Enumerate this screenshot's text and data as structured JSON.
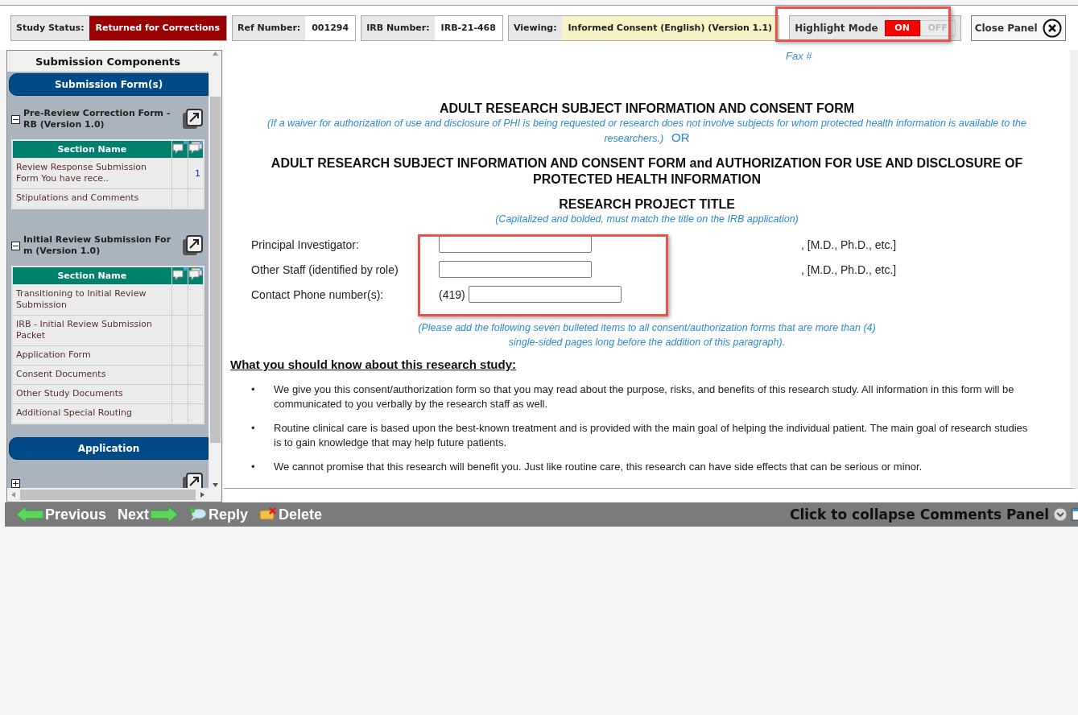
{
  "status_bar": {
    "fields": [
      {
        "label": "Study Status:",
        "value": "Returned for Corrections",
        "kind": "alert"
      },
      {
        "label": "Ref Number:",
        "value": "001294",
        "kind": "plain"
      },
      {
        "label": "IRB Number:",
        "value": "IRB-21-468",
        "kind": "plain"
      },
      {
        "label": "Viewing:",
        "value": "Informed Consent (English) (Version 1.1)",
        "kind": "note"
      }
    ],
    "highlight": {
      "label": "Highlight Mode",
      "options": [
        {
          "label": "ON",
          "selected": true
        },
        {
          "label": "OFF",
          "selected": false
        }
      ]
    },
    "close_label": "Close Panel"
  },
  "sidebar": {
    "title": "Submission Components",
    "sections": [
      {
        "title": "Submission Form(s)",
        "forms": [
          {
            "title": "Pre-Review Correction Form - RB (Version 1.0)",
            "expanded": true,
            "column": "Section Name",
            "rows": [
              {
                "name": "Review Response Submission Form You have rece..",
                "count": "1"
              },
              {
                "name": "Stipulations and Comments"
              }
            ]
          },
          {
            "title": "Initial Review Submission For m (Version 1.0)",
            "expanded": true,
            "column": "Section Name",
            "rows": [
              {
                "name": "Transitioning to Initial Review Submission"
              },
              {
                "name": "IRB - Initial Review Submission Packet"
              },
              {
                "name": "Application Form"
              },
              {
                "name": "Consent Documents"
              },
              {
                "name": "Other Study Documents"
              },
              {
                "name": "Additional Special Routing"
              }
            ]
          }
        ]
      },
      {
        "title": "Application",
        "forms": [
          {
            "expanded": false
          }
        ]
      }
    ]
  },
  "document": {
    "fax_label": "Fax #",
    "title": "ADULT RESEARCH SUBJECT INFORMATION AND CONSENT FORM",
    "waiver_note": "(If a waiver for authorization of use and disclosure of PHI is being requested or research does not involve subjects for whom protected health information is available to the researchers.)",
    "or_label": "OR",
    "title_2": "ADULT RESEARCH SUBJECT INFORMATION AND CONSENT FORM and AUTHORIZATION FOR USE AND DISCLOSURE OF PROTECTED HEALTH INFORMATION",
    "project_title": "RESEARCH PROJECT TITLE",
    "project_note": "(Capitalized and bolded, must match the title on the IRB application)",
    "fields": [
      {
        "label": "Principal Investigator:",
        "suffix": ", [M.D., Ph.D., etc.]"
      },
      {
        "label": "Other Staff (identified by role)",
        "suffix": ", [M.D., Ph.D., etc.]"
      },
      {
        "label": "Contact Phone number(s):",
        "prefix": "(419)"
      }
    ],
    "bullets_note": "(Please add the following seven bulleted items to all consent/authorization forms that are more than (4) single-sided pages long before the addition of this paragraph).",
    "heading": "What you should know about this research study:",
    "bullet_marker": "•",
    "bullets": [
      "We give you this consent/authorization form so that you may read about the purpose, risks, and benefits of this research study. All information in this form will be communicated to you verbally by the research staff as well.",
      "Routine clinical care is based upon the best-known treatment and is provided with the main goal of helping the individual patient.  The main goal of research studies is to gain knowledge that may help future patients.",
      "We cannot promise that this research will benefit you.  Just like routine care, this research can have side effects that can be serious or minor."
    ]
  },
  "toolbar": {
    "buttons": [
      {
        "label": "Previous",
        "kind": "previous"
      },
      {
        "label": "Next",
        "kind": "next"
      },
      {
        "label": "Reply",
        "kind": "reply"
      },
      {
        "label": "Delete",
        "kind": "delete"
      }
    ],
    "collapse_label": "Click to collapse Comments Panel"
  }
}
